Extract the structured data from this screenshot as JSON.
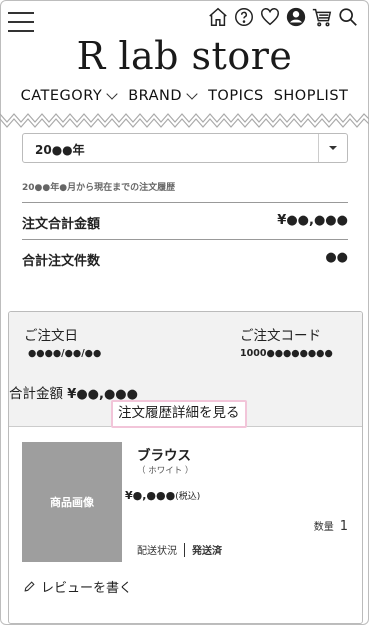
{
  "header": {
    "logo": "R lab store",
    "nav": [
      "CATEGORY",
      "BRAND",
      "TOPICS",
      "SHOPLIST"
    ],
    "icons": [
      "home-icon",
      "help-icon",
      "heart-icon",
      "user-icon",
      "cart-icon",
      "search-icon"
    ]
  },
  "summary": {
    "year_select": "20●●年",
    "history_note": "20●●年●月から現在までの注文履歴",
    "total_amount_label": "注文合計金額",
    "total_amount_value": "¥●●,●●●",
    "total_count_label": "合計注文件数",
    "total_count_value": "●●"
  },
  "order": {
    "date_label": "ご注文日",
    "date_value": "●●●●/●●/●●",
    "code_label": "ご注文コード",
    "code_value": "1000●●●●●●●●",
    "total_label": "合計金額",
    "total_value": "¥●●,●●●",
    "detail_button": "注文履歴詳細を見る",
    "item": {
      "image_label": "商品画像",
      "name": "ブラウス",
      "color": "（ ホワイト ）",
      "price": "¥●,●●●",
      "tax": "(税込)",
      "qty_label": "数量",
      "qty_value": "1",
      "ship_label": "配送状況",
      "ship_value": "発送済"
    },
    "review_label": "レビューを書く"
  }
}
